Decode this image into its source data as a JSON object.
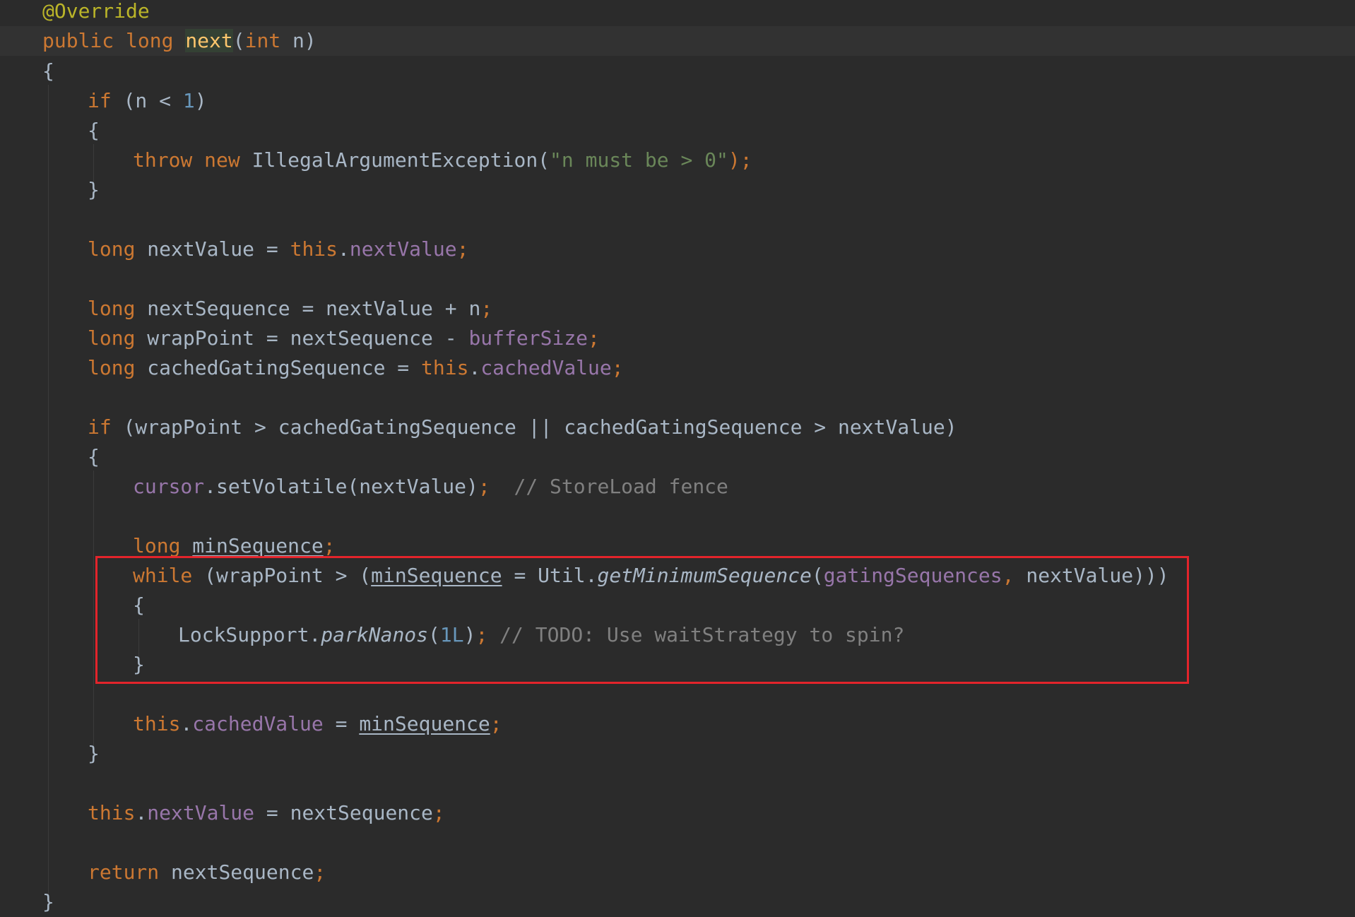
{
  "code": {
    "l01": {
      "annotation": "@Override"
    },
    "l02": {
      "kw1": "public",
      "kw2": "long",
      "method": "next",
      "p1": "(",
      "kw3": "int",
      "p2": " n)"
    },
    "l03": {
      "brace": "{"
    },
    "l04": {
      "kw": "if",
      "p1": " (n < ",
      "num": "1",
      "p2": ")"
    },
    "l05": {
      "brace": "{"
    },
    "l06": {
      "kw1": "throw",
      "kw2": "new",
      "cls": " IllegalArgumentException(",
      "str": "\"n must be > 0\"",
      "end": ");"
    },
    "l07": {
      "brace": "}"
    },
    "l08": {
      "kw": "long",
      "p1": " nextValue = ",
      "kw2": "this",
      "dot": ".",
      "field": "nextValue",
      "semi": ";"
    },
    "l09": {
      "kw": "long",
      "p1": " nextSequence = nextValue + n",
      "semi": ";"
    },
    "l10": {
      "kw": "long",
      "p1": " wrapPoint = nextSequence - ",
      "field": "bufferSize",
      "semi": ";"
    },
    "l11": {
      "kw": "long",
      "p1": " cachedGatingSequence = ",
      "kw2": "this",
      "dot": ".",
      "field": "cachedValue",
      "semi": ";"
    },
    "l12": {
      "kw": "if",
      "p1": " (wrapPoint > cachedGatingSequence || cachedGatingSequence > nextValue)"
    },
    "l13": {
      "brace": "{"
    },
    "l14": {
      "field": "cursor",
      "p1": ".setVolatile(nextValue)",
      "semi": ";",
      "cmt": "  // StoreLoad fence"
    },
    "l15": {
      "kw": "long",
      "sp": " ",
      "var": "minSequence",
      "semi": ";"
    },
    "l16": {
      "kw": "while",
      "p1": " (wrapPoint > (",
      "var": "minSequence",
      "p2": " = Util.",
      "method": "getMinimumSequence",
      "p3": "(",
      "field": "gatingSequences",
      "comma": ",",
      "p4": " nextValue)))"
    },
    "l17": {
      "brace": "{"
    },
    "l18": {
      "p1": "LockSupport.",
      "method": "parkNanos",
      "p2": "(",
      "num": "1L",
      "p3": ")",
      "semi": ";",
      "cmt": " // TODO: Use waitStrategy to spin?"
    },
    "l19": {
      "brace": "}"
    },
    "l20": {
      "kw": "this",
      "dot": ".",
      "field": "cachedValue",
      "p1": " = ",
      "var": "minSequence",
      "semi": ";"
    },
    "l21": {
      "brace": "}"
    },
    "l22": {
      "kw": "this",
      "dot": ".",
      "field": "nextValue",
      "p1": " = nextSequence",
      "semi": ";"
    },
    "l23": {
      "kw": "return",
      "p1": " nextSequence",
      "semi": ";"
    },
    "l24": {
      "brace": "}"
    }
  },
  "colors": {
    "background": "#2b2b2b",
    "keyword": "#cc7832",
    "annotation": "#bbb529",
    "number": "#6897bb",
    "string": "#6a8759",
    "field": "#9876aa",
    "comment": "#808080",
    "default_text": "#a9b7c6",
    "highlight_box": "#e3242b"
  }
}
